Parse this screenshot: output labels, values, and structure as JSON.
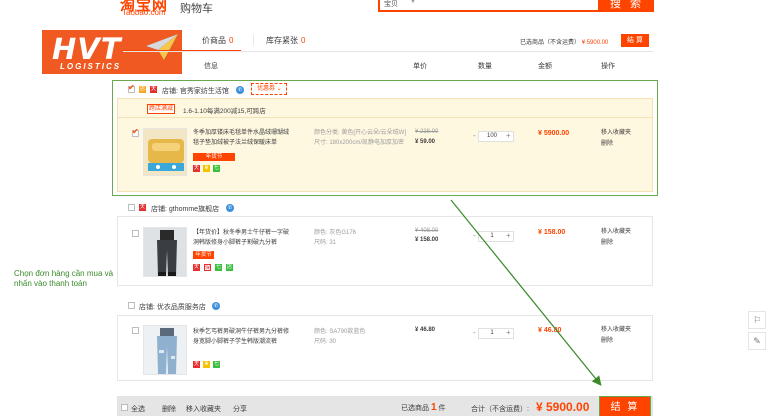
{
  "header": {
    "logo": "淘宝网",
    "logo_sub": "Taobao.com",
    "title": "购物车",
    "search_scope": "宝贝",
    "search_button": "搜 索"
  },
  "watermark": {
    "brand": "HVT",
    "sub": "LOGISTICS"
  },
  "tabs": [
    {
      "label": "价商品",
      "count": "0"
    },
    {
      "label": "库存紧张",
      "count": "0"
    }
  ],
  "summary": {
    "label": "已选商品（不含运费）",
    "price": "¥ 5900.00",
    "checkout": "结 算"
  },
  "columns": {
    "info": "信息",
    "price": "单价",
    "qty": "数量",
    "amount": "金额",
    "ops": "操作"
  },
  "shops": [
    {
      "name": "店铺: 官秀家纺生活馆",
      "coupon": "优惠券",
      "promo_tag": "跨店满减",
      "promo_text": "1.6-1.10每满200减15,可跨店",
      "item": {
        "title": "冬季加厚镂床毛毯单件水晶绒珊瑚绒毯子垫加绒被子法兰绒保暖床单",
        "tag": "年货节",
        "props": [
          "颜色分类: 黄色[开心云朵/云朵绒W]",
          "尺寸: 180x200cm/凯静电加厚加密"
        ],
        "old_price": "¥ 238.00",
        "price": "¥ 59.00",
        "qty": "100",
        "amount": "¥ 5900.00",
        "ops": [
          "移入收藏夹",
          "删除"
        ]
      }
    },
    {
      "name": "店铺: gthomme旗舰店",
      "item": {
        "title": "【年货价】秋冬季男士牛仔裤一字破洞韩版修身小脚裤子割破九分裤",
        "tag": "年货节",
        "props": [
          "颜色: 灰色G176",
          "尺码: 31"
        ],
        "old_price": "¥ 408.00",
        "price": "¥ 158.00",
        "qty": "1",
        "amount": "¥ 158.00",
        "ops": [
          "移入收藏夹",
          "删除"
        ]
      }
    },
    {
      "name": "店铺: 优衣品质服务店",
      "item": {
        "title": "秋季乞丐裤男破洞牛仔裤男九分裤修身宽脚小脚裤子学生韩版潮流裤",
        "props": [
          "颜色: SA790款蓝色",
          "尺码: 30"
        ],
        "price": "¥ 46.80",
        "qty": "1",
        "amount": "¥ 46.80",
        "ops": [
          "移入收藏夹",
          "删除"
        ]
      }
    }
  ],
  "annotation": "Chọn đơn hàng cần mua và nhấn vào thanh toán",
  "bottom": {
    "select_all": "全选",
    "delete": "删除",
    "move_fav": "移入收藏夹",
    "share": "分享",
    "selected_label": "已选商品",
    "selected_count": "1",
    "selected_unit": "件",
    "total_label": "合计（不含运费）:",
    "total": "¥ 5900.00",
    "checkout": "结 算"
  },
  "colors": {
    "accent": "#ff4400",
    "annotation": "#6aa84f",
    "selected_bg": "#fff8e1"
  }
}
